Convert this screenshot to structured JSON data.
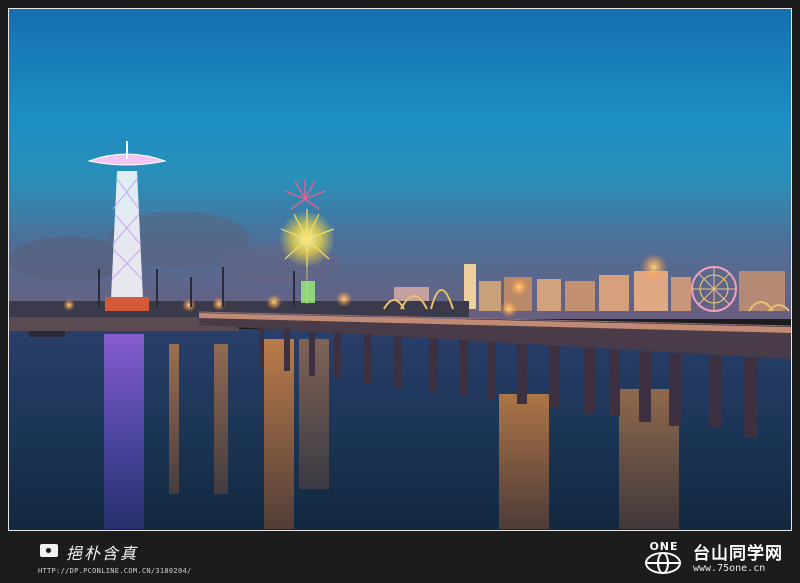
{
  "photo": {
    "subject": "Night pier with fireworks, parachute tower and illuminated city skyline reflected in water",
    "colors": {
      "sky_top": "#1677b8",
      "sky_mid": "#1d8fc4",
      "sky_horizon": "#4c6e9a",
      "water": "#1a3555",
      "frame_bg": "#1c1c1c"
    }
  },
  "footer": {
    "signature": "挹朴含真",
    "blog_url": "HTTP://DP.PCONLINE.COM.CN/3180204/",
    "logo_text": "ONE",
    "site_name": "台山同学网",
    "site_url": "www.75one.cn"
  }
}
